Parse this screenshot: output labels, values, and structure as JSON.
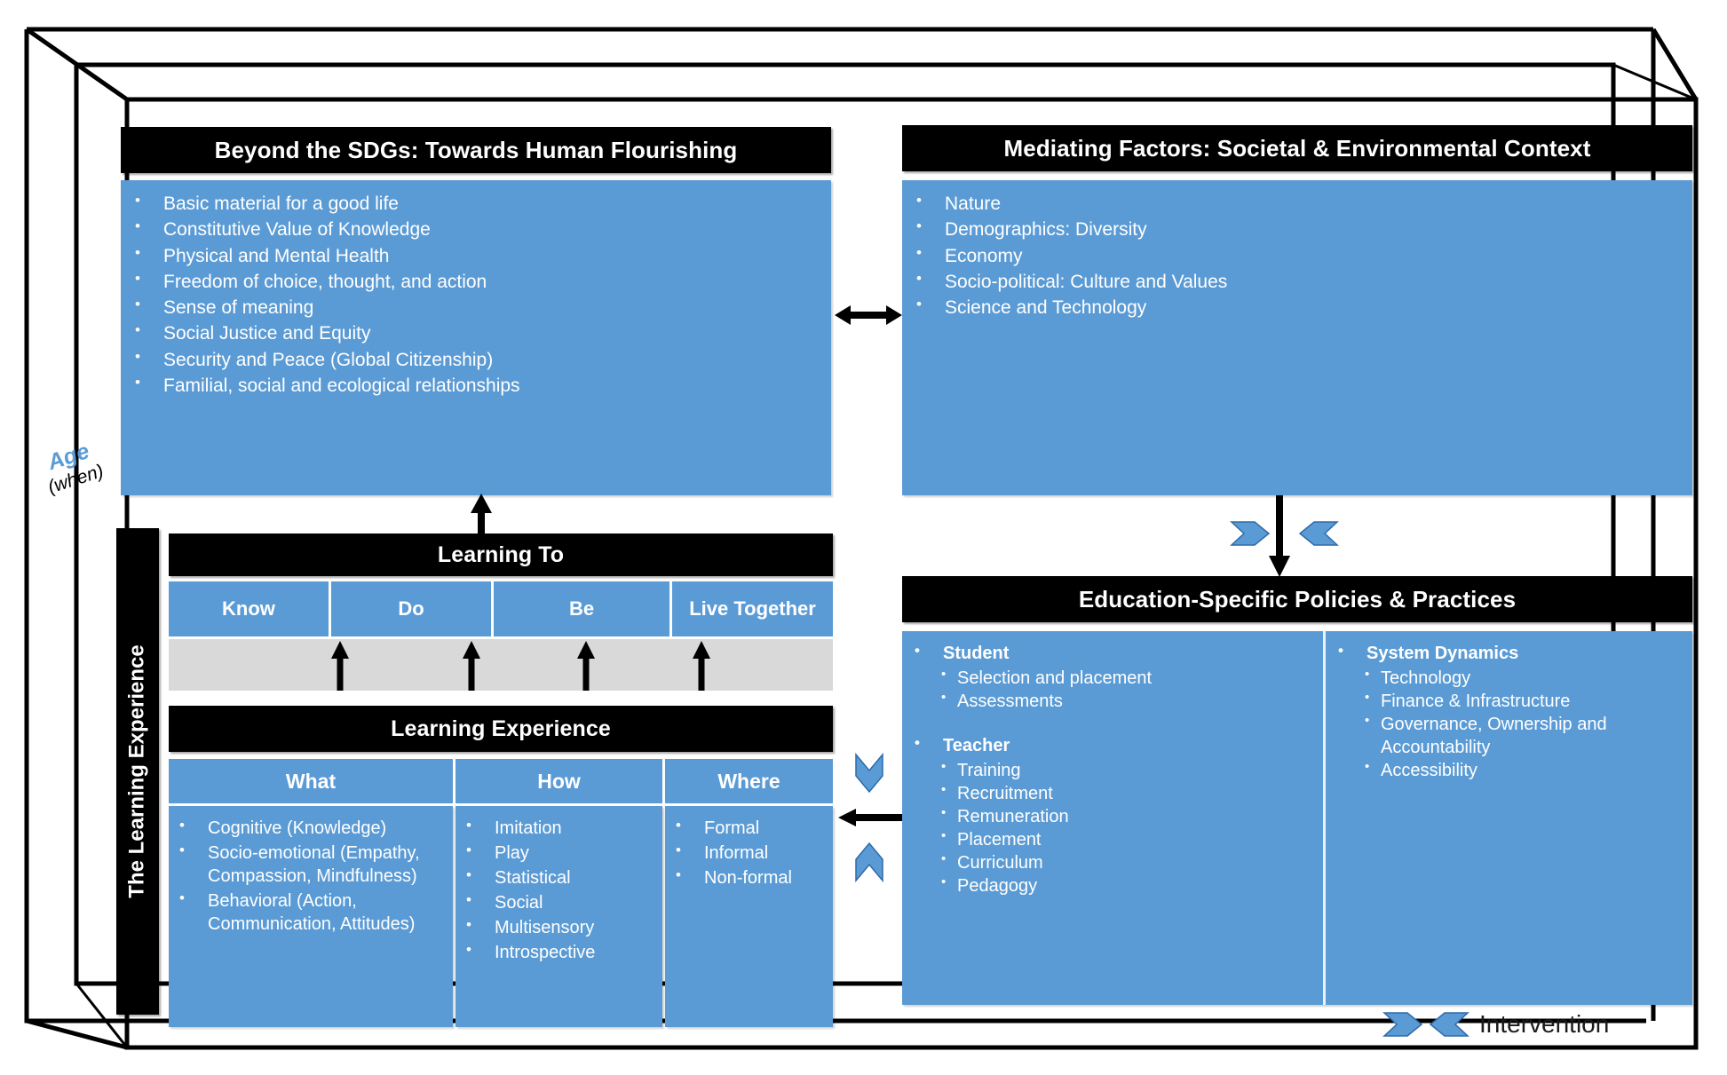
{
  "diagram": {
    "axis_label": {
      "main": "Age",
      "sub": "(when)"
    },
    "legend": {
      "label": "Intervention",
      "icon_right": "chevron-right-icon",
      "icon_left": "chevron-left-icon"
    },
    "vertical_label": "The Learning Experience",
    "colors": {
      "blue": "#5B9BD5",
      "black": "#000000",
      "gray": "#D9D9D9",
      "white": "#FFFFFF"
    }
  },
  "panels": {
    "flourishing": {
      "title": "Beyond the SDGs: Towards Human Flourishing",
      "items": [
        "Basic material for a good life",
        "Constitutive Value of Knowledge",
        "Physical and Mental Health",
        "Freedom of choice, thought, and action",
        "Sense of meaning",
        "Social Justice and Equity",
        "Security and Peace (Global Citizenship)",
        "Familial, social and ecological relationships"
      ]
    },
    "mediating": {
      "title": "Mediating Factors: Societal & Environmental Context",
      "items": [
        "Nature",
        "Demographics: Diversity",
        "Economy",
        "Socio-political: Culture and Values",
        "Science and Technology"
      ]
    },
    "policies": {
      "title": "Education-Specific Policies & Practices",
      "left_groups": [
        {
          "heading": "Student",
          "items": [
            "Selection and placement",
            "Assessments"
          ]
        },
        {
          "heading": "Teacher",
          "items": [
            "Training",
            "Recruitment",
            "Remuneration",
            "Placement",
            "Curriculum",
            "Pedagogy"
          ]
        }
      ],
      "right_groups": [
        {
          "heading": "System Dynamics",
          "items": [
            "Technology",
            "Finance & Infrastructure",
            "Governance, Ownership and Accountability",
            "Accessibility"
          ]
        }
      ]
    },
    "learning_to": {
      "title": "Learning To",
      "columns": [
        "Know",
        "Do",
        "Be",
        "Live Together"
      ]
    },
    "learning_experience": {
      "title": "Learning Experience",
      "columns": [
        {
          "header": "What",
          "items": [
            "Cognitive (Knowledge)",
            "Socio-emotional (Empathy, Compassion, Mindfulness)",
            "Behavioral (Action, Communication, Attitudes)"
          ]
        },
        {
          "header": "How",
          "items": [
            "Imitation",
            "Play",
            "Statistical",
            "Social",
            "Multisensory",
            "Introspective"
          ]
        },
        {
          "header": "Where",
          "items": [
            "Formal",
            "Informal",
            "Non-formal"
          ]
        }
      ]
    }
  }
}
